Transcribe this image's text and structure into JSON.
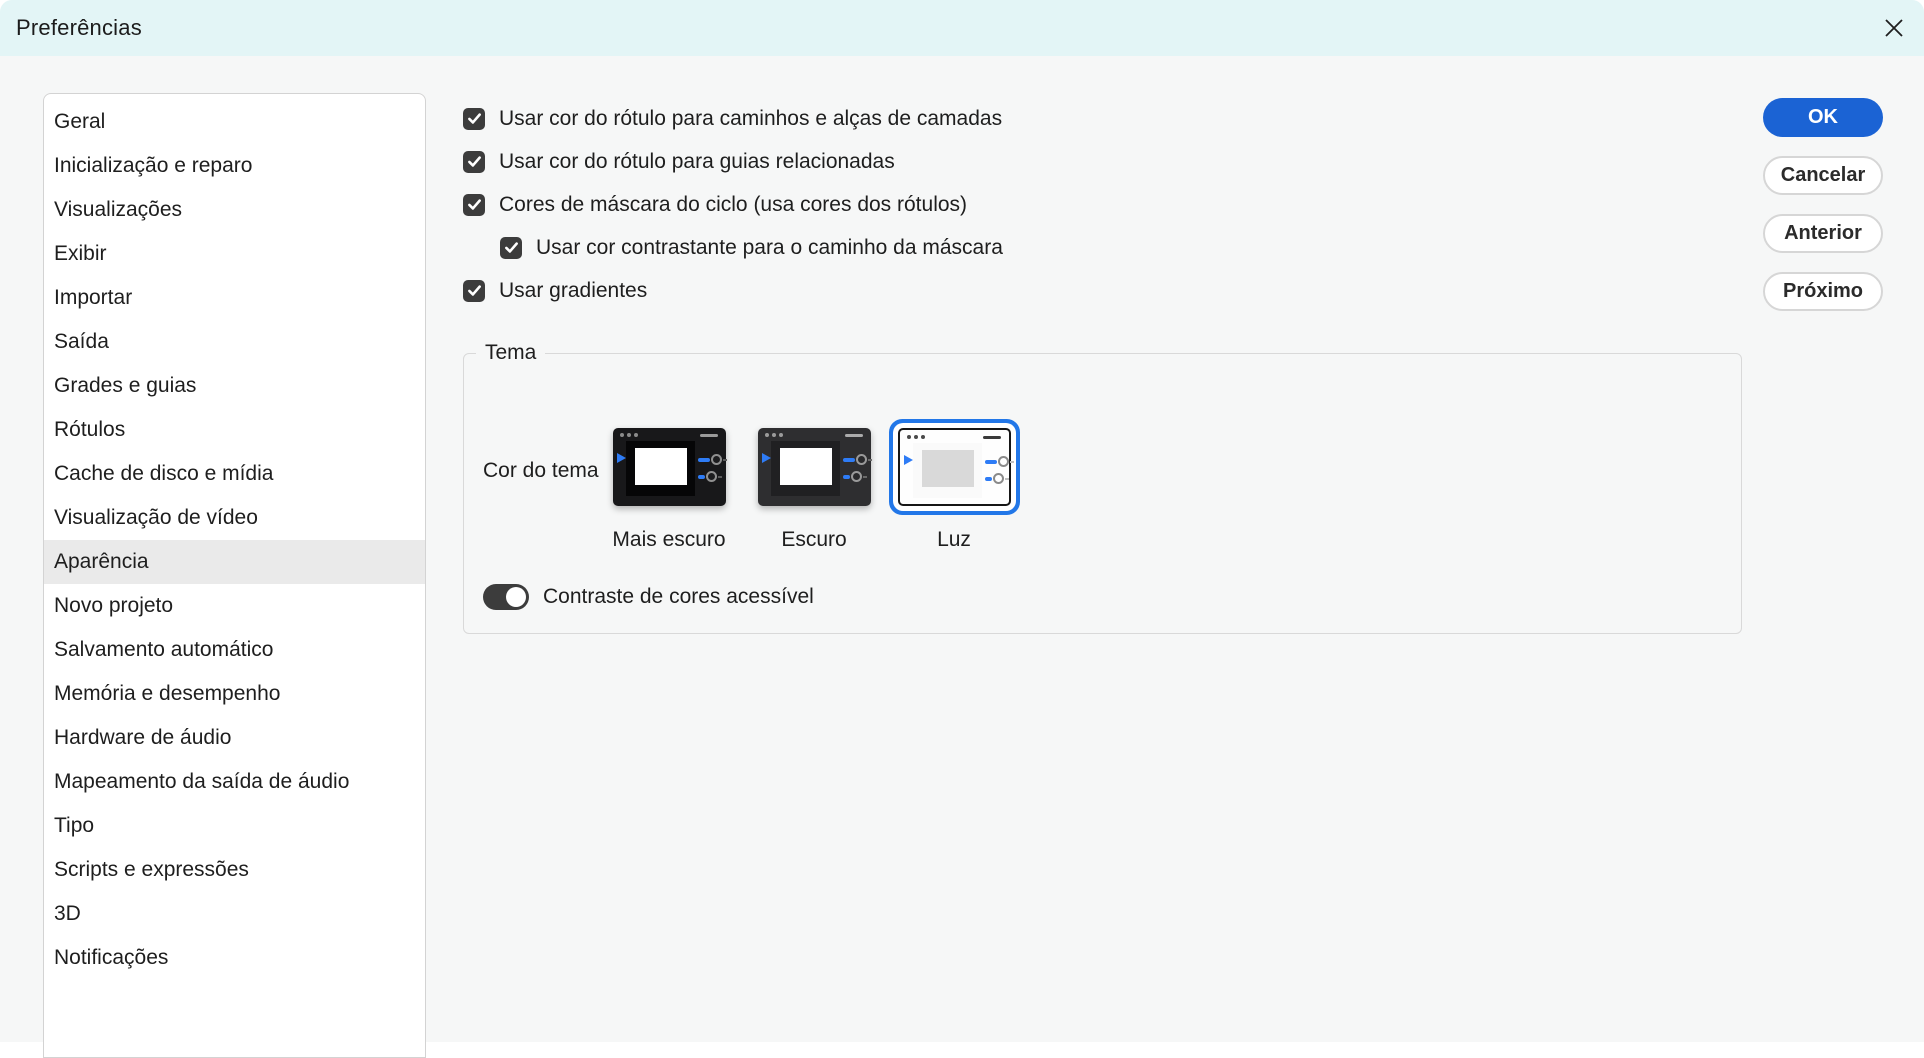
{
  "window": {
    "title": "Preferências"
  },
  "sidebar": {
    "items": [
      {
        "label": "Geral",
        "selected": false
      },
      {
        "label": "Inicialização e reparo",
        "selected": false
      },
      {
        "label": "Visualizações",
        "selected": false
      },
      {
        "label": "Exibir",
        "selected": false
      },
      {
        "label": "Importar",
        "selected": false
      },
      {
        "label": "Saída",
        "selected": false
      },
      {
        "label": "Grades e guias",
        "selected": false
      },
      {
        "label": "Rótulos",
        "selected": false
      },
      {
        "label": "Cache de disco e mídia",
        "selected": false
      },
      {
        "label": "Visualização de vídeo",
        "selected": false
      },
      {
        "label": "Aparência",
        "selected": true
      },
      {
        "label": "Novo projeto",
        "selected": false
      },
      {
        "label": "Salvamento automático",
        "selected": false
      },
      {
        "label": "Memória e desempenho",
        "selected": false
      },
      {
        "label": "Hardware de áudio",
        "selected": false
      },
      {
        "label": "Mapeamento da saída de áudio",
        "selected": false
      },
      {
        "label": "Tipo",
        "selected": false
      },
      {
        "label": "Scripts e expressões",
        "selected": false
      },
      {
        "label": "3D",
        "selected": false
      },
      {
        "label": "Notificações",
        "selected": false
      }
    ]
  },
  "options": [
    {
      "label": "Usar cor do rótulo para caminhos e alças de camadas",
      "checked": true,
      "indent": 0
    },
    {
      "label": "Usar cor do rótulo para guias relacionadas",
      "checked": true,
      "indent": 0
    },
    {
      "label": "Cores de máscara do ciclo (usa cores dos rótulos)",
      "checked": true,
      "indent": 0
    },
    {
      "label": "Usar cor contrastante para o caminho da máscara",
      "checked": true,
      "indent": 1
    },
    {
      "label": "Usar gradientes",
      "checked": true,
      "indent": 0
    }
  ],
  "theme": {
    "legend": "Tema",
    "color_label": "Cor do tema",
    "options": [
      {
        "label": "Mais escuro",
        "variant": "darkest",
        "selected": false
      },
      {
        "label": "Escuro",
        "variant": "dark",
        "selected": false
      },
      {
        "label": "Luz",
        "variant": "light",
        "selected": true
      }
    ],
    "toggle": {
      "label": "Contraste de cores acessível",
      "on": true
    }
  },
  "actions": [
    {
      "label": "OK",
      "primary": true
    },
    {
      "label": "Cancelar",
      "primary": false
    },
    {
      "label": "Anterior",
      "primary": false
    },
    {
      "label": "Próximo",
      "primary": false
    }
  ],
  "colors": {
    "titlebar_bg": "#E3F5F6",
    "body_bg": "#F6F7F7",
    "accent_blue": "#1B63D4",
    "selection_blue": "#2277E8",
    "play_blue": "#2E7CF6",
    "control_dark": "#3C3C3C",
    "sidebar_selected_bg": "#EAEAEA"
  }
}
